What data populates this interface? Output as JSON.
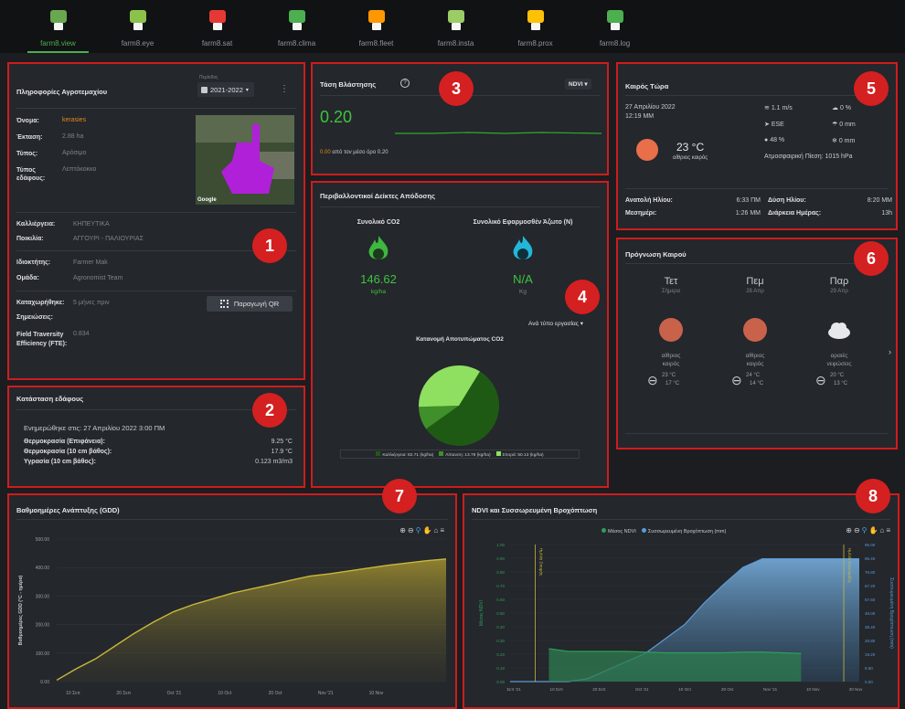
{
  "nav": [
    {
      "label": "farm8.view",
      "icon": "map-tree-icon",
      "color": "#6aa84f"
    },
    {
      "label": "farm8.eye",
      "icon": "drone-eye-icon",
      "color": "#8bc34a"
    },
    {
      "label": "farm8.sat",
      "icon": "satellite-icon",
      "color": "#e53935"
    },
    {
      "label": "farm8.clima",
      "icon": "clima-station-icon",
      "color": "#4caf50"
    },
    {
      "label": "farm8.fleet",
      "icon": "tractor-icon",
      "color": "#ff9800"
    },
    {
      "label": "farm8.insta",
      "icon": "insta-icon",
      "color": "#9ccc65"
    },
    {
      "label": "farm8.prox",
      "icon": "proximity-icon",
      "color": "#ffc107"
    },
    {
      "label": "farm8.log",
      "icon": "log-icon",
      "color": "#4caf50"
    }
  ],
  "badges": [
    "1",
    "2",
    "3",
    "4",
    "5",
    "6",
    "7",
    "8"
  ],
  "info": {
    "title": "Πληροφορίες Αγροτεμαχίου",
    "period_label": "Περίοδος",
    "period": "2021-2022",
    "rows": [
      {
        "k": "Όνομα:",
        "v": "kerasies"
      },
      {
        "k": "Έκταση:",
        "v": "2.88 ha"
      },
      {
        "k": "Τύπος:",
        "v": "Αρόσιμο"
      },
      {
        "k": "Τύπος εδάφους:",
        "v": "Λεπτόκοκκο"
      }
    ],
    "crop_k": "Καλλιέργεια:",
    "crop_v": "ΚΗΠΕΥΤΙΚΑ",
    "variety_k": "Ποικιλία:",
    "variety_v": "ΑΓΓΟΥΡΙ - ΠΑΛΙΟΥΡΙΑΣ",
    "owner_k": "Ιδιοκτήτης:",
    "owner_v": "Farmer Mak",
    "group_k": "Ομάδα:",
    "group_v": "Agronomist Team",
    "registered_k": "Καταχωρήθηκε:",
    "registered_v": "5 μήνες πριν",
    "notes_k": "Σημειώσεις:",
    "fte_k": "Field Traversity Efficiency (FTE):",
    "fte_v": "0.834",
    "qr_button": "Παραγωγή QR",
    "map_credit": "Google"
  },
  "soil": {
    "title": "Κατάσταση εδάφους",
    "updated": "Ενημερώθηκε στις: 27 Απριλίου 2022 3:00 ΠΜ",
    "rows": [
      {
        "k": "Θερμοκρασία (Επιφάνεια):",
        "v": "9.25 °C"
      },
      {
        "k": "Θερμοκρασία (10 cm βάθος):",
        "v": "17.9 °C"
      },
      {
        "k": "Υγρασία (10 cm βάθος):",
        "v": "0.123 m3/m3"
      }
    ]
  },
  "trend": {
    "title": "Τάση Βλάστησης",
    "index": "NDVI",
    "value": "0.20",
    "note_value": "0.00",
    "note": "από τον μέσο όρο 0.20"
  },
  "env": {
    "title": "Περιβαλλοντικοί Δείκτες Απόδοσης",
    "co2_label": "Συνολικό CO2",
    "co2_value": "146.62",
    "co2_unit": "kg/ha",
    "n_label": "Συνολικό Εφαρμοσθέν Άζωτο (N)",
    "n_value": "N/A",
    "n_unit": "Kg",
    "dropdown": "Ανά τύπο εργασίας",
    "pie_title": "Κατανομή Αποτυπώματος CO2",
    "legend": [
      {
        "label": "Καλλιέργεια: 82.71 (kg/ha)",
        "color": "#1f5a14"
      },
      {
        "label": "Λίπανση: 13.78 (kg/ha)",
        "color": "#3f8f2a"
      },
      {
        "label": "Σπορά: 50.13 (kg/ha)",
        "color": "#8fe060"
      }
    ]
  },
  "weather": {
    "title": "Καιρός Τώρα",
    "date": "27 Απριλίου 2022",
    "time": "12:19 ΜΜ",
    "temp": "23 °C",
    "desc": "αίθριος καιρός",
    "wind": "1.1 m/s",
    "dir": "ESE",
    "humidity": "48 %",
    "cloud": "0 %",
    "rain": "0 mm",
    "snow": "0 mm",
    "pressure": "Ατμοσφαιρική Πίεση: 1015 hPa",
    "sunrise_k": "Ανατολή Ηλίου:",
    "sunrise_v": "6:33 ΠΜ",
    "noon_k": "Μεσημέρι:",
    "noon_v": "1:26 ΜΜ",
    "sunset_k": "Δύση Ηλίου:",
    "sunset_v": "8:20 ΜΜ",
    "daylen_k": "Διάρκεια Ημέρας:",
    "daylen_v": "13h"
  },
  "forecast": {
    "title": "Πρόγνωση Καιρού",
    "days": [
      {
        "day": "Τετ",
        "date": "Σήμερα",
        "desc1": "αίθριος",
        "desc2": "καιρός",
        "hi": "23 °C",
        "lo": "17 °C",
        "icon": "sun-icon"
      },
      {
        "day": "Πεμ",
        "date": "28 Απρ",
        "desc1": "αίθριος",
        "desc2": "καιρός",
        "hi": "24 °C",
        "lo": "14 °C",
        "icon": "sun-icon"
      },
      {
        "day": "Παρ",
        "date": "29 Απρ",
        "desc1": "αραιές",
        "desc2": "νεφώσεις",
        "hi": "20 °C",
        "lo": "13 °C",
        "icon": "cloud-icon"
      }
    ]
  },
  "chart_data": [
    {
      "type": "area",
      "title": "Βαθμοημέρες Ανάπτυξης (GDD)",
      "ylabel": "Βαθμοημέρες GDD (°C - ημέρα)",
      "xlabel": "",
      "ylim": [
        0,
        500
      ],
      "yticks": [
        "0.00",
        "100.00",
        "200.00",
        "300.00",
        "400.00",
        "500.00"
      ],
      "xticks": [
        "10 Σεπ",
        "20 Σεπ",
        "Oct '21",
        "10 Oct",
        "20 Oct",
        "Nov '21",
        "10 Nov"
      ],
      "x": [
        0,
        1,
        2,
        3,
        4,
        5,
        6,
        7,
        8,
        9,
        10,
        11,
        12,
        13,
        14,
        15,
        16,
        17,
        18,
        19,
        20
      ],
      "values": [
        5,
        45,
        80,
        125,
        170,
        210,
        245,
        270,
        290,
        310,
        325,
        340,
        355,
        370,
        378,
        388,
        398,
        408,
        416,
        424,
        430
      ],
      "color": "#c9b83a",
      "grid": true
    },
    {
      "type": "line",
      "title": "NDVI και Συσσωρευμένη Βροχόπτωση",
      "series": [
        {
          "name": "Μέσος NDVI",
          "color": "#2e9e5a",
          "x": [
            2,
            3,
            4,
            5,
            6,
            7,
            8,
            9,
            10,
            11,
            12,
            13,
            14,
            15
          ],
          "values": [
            0.24,
            0.22,
            0.22,
            0.22,
            0.22,
            0.215,
            0.21,
            0.21,
            0.21,
            0.21,
            0.215,
            0.215,
            0.21,
            0.205
          ]
        },
        {
          "name": "Συσσωρευμένη Βροχόπτωση (mm)",
          "color": "#5b9bd5",
          "x": [
            0,
            3,
            4,
            5,
            6,
            7,
            8,
            9,
            10,
            11,
            12,
            13,
            14,
            18
          ],
          "values": [
            0,
            0,
            2,
            8,
            14,
            20,
            30,
            40,
            55,
            68,
            80,
            86,
            86,
            86
          ]
        }
      ],
      "ylabel_left": "Μέσος NDVI",
      "ylabel_right": "Συσσωρευμένη Βροχόπτωση (mm)",
      "yticks_left": [
        "0.00",
        "0.10",
        "0.20",
        "0.30",
        "0.40",
        "0.50",
        "0.60",
        "0.70",
        "0.80",
        "0.90",
        "1.00"
      ],
      "yticks_right": [
        "0.00",
        "9.60",
        "19.20",
        "28.80",
        "38.40",
        "48.00",
        "57.60",
        "67.20",
        "76.80",
        "86.40",
        "96.00"
      ],
      "xticks": [
        "Σεπ '21",
        "10 Σεπ",
        "20 Σεπ",
        "Oct '21",
        "10 Oct",
        "20 Oct",
        "Nov '21",
        "10 Nov",
        "20 Nov"
      ],
      "annotations": [
        "Ημ/νία Σποράς",
        "Ημ/νία Συγκομιδής"
      ],
      "grid": true
    }
  ]
}
